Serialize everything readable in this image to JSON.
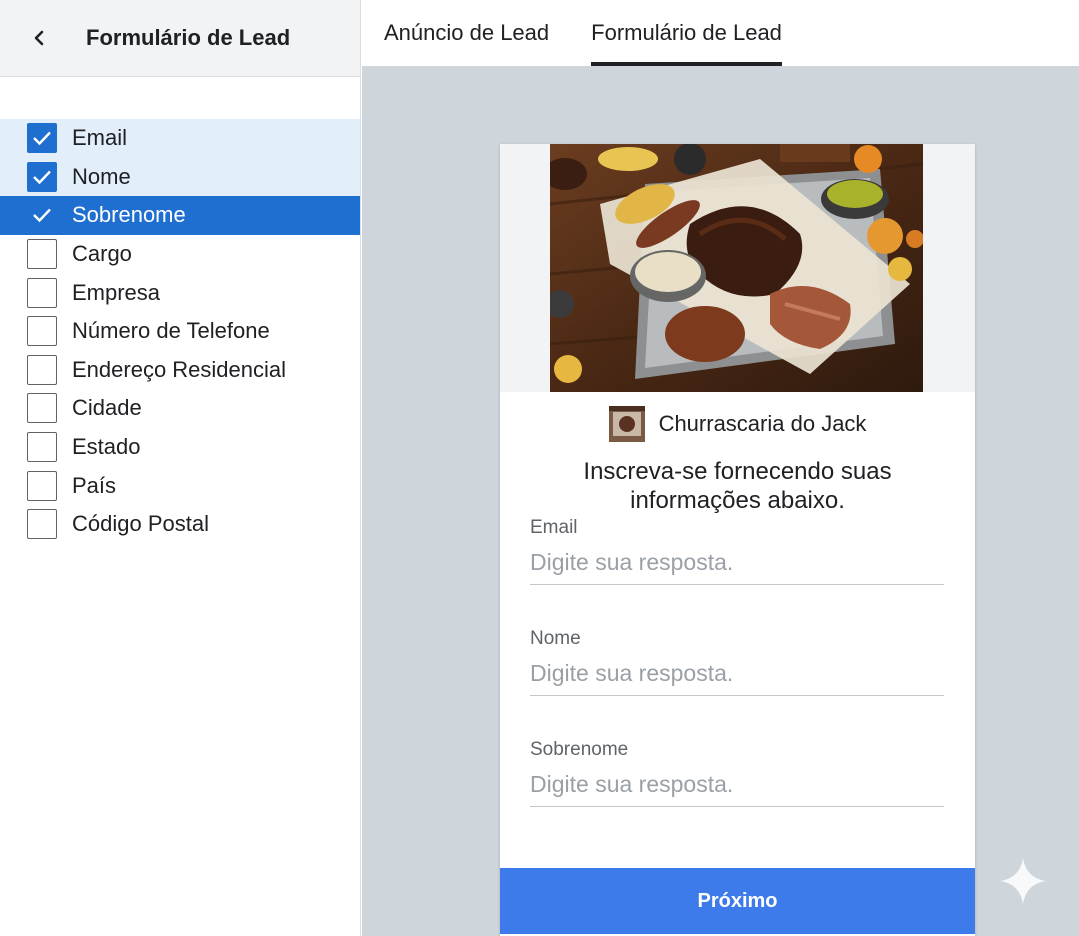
{
  "left_panel": {
    "title": "Formulário de Lead",
    "fields": [
      {
        "label": "Email",
        "checked": true
      },
      {
        "label": "Nome",
        "checked": true
      },
      {
        "label": "Sobrenome",
        "checked": true
      },
      {
        "label": "Cargo",
        "checked": false
      },
      {
        "label": "Empresa",
        "checked": false
      },
      {
        "label": "Número de Telefone",
        "checked": false
      },
      {
        "label": "Endereço Residencial",
        "checked": false
      },
      {
        "label": "Cidade",
        "checked": false
      },
      {
        "label": "Estado",
        "checked": false
      },
      {
        "label": "País",
        "checked": false
      },
      {
        "label": "Código Postal",
        "checked": false
      }
    ]
  },
  "tabs": [
    {
      "label": "Anúncio de Lead",
      "active": false
    },
    {
      "label": "Formulário de Lead",
      "active": true
    }
  ],
  "preview": {
    "advertiser_name": "Churrascaria do Jack",
    "intro_text": "Inscreva-se fornecendo suas informações abaixo.",
    "form_fields": [
      {
        "label": "Email",
        "placeholder": "Digite sua resposta."
      },
      {
        "label": "Nome",
        "placeholder": "Digite sua resposta."
      },
      {
        "label": "Sobrenome",
        "placeholder": "Digite sua resposta."
      }
    ],
    "next_label": "Próximo"
  },
  "colors": {
    "accent": "#1f6fd1",
    "selected_light": "#e3eefb",
    "button_blue": "#3d7bea",
    "canvas_gray": "#cfd6db"
  }
}
